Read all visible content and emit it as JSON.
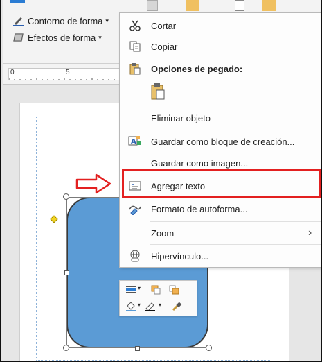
{
  "ribbon": {
    "shape_outline_label": "Contorno de forma",
    "shape_effects_label": "Efectos de forma"
  },
  "ruler": {
    "tick_0": "0",
    "tick_5": "5"
  },
  "context_menu": {
    "cut": "Cortar",
    "copy": "Copiar",
    "paste_options": "Opciones de pegado:",
    "delete_object": "Eliminar objeto",
    "save_building_block": "Guardar como bloque de creación...",
    "save_as_image": "Guardar como imagen...",
    "add_text": "Agregar texto",
    "autoshape_format": "Formato de autoforma...",
    "zoom": "Zoom",
    "hyperlink": "Hipervínculo..."
  },
  "colors": {
    "shape_fill": "#5b9bd5",
    "highlight": "#e32020",
    "adjust_handle": "#f1d322"
  }
}
